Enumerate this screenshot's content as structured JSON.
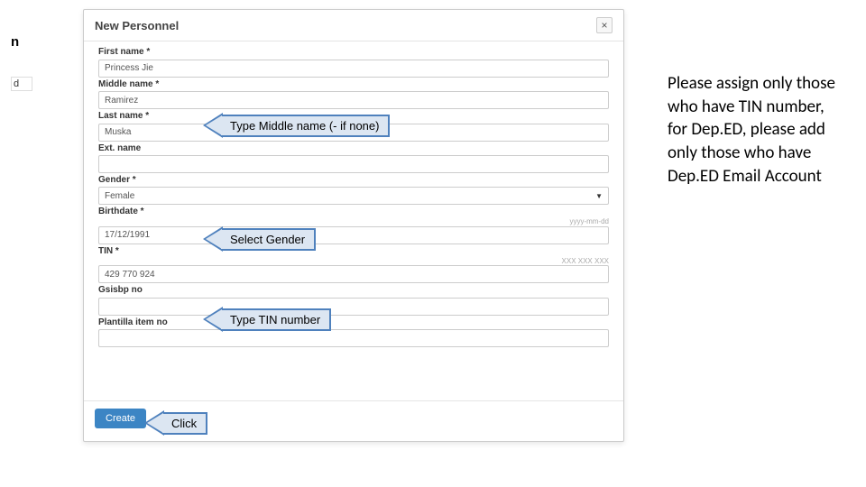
{
  "left_fragments": {
    "frag1": "n",
    "frag2": "d"
  },
  "modal": {
    "title": "New Personnel",
    "close_symbol": "×",
    "fields": {
      "first_name": {
        "label": "First name *",
        "value": "Princess Jie"
      },
      "middle_name": {
        "label": "Middle name *",
        "value": "Ramirez"
      },
      "last_name": {
        "label": "Last name *",
        "value": "Muska"
      },
      "ext_name": {
        "label": "Ext. name",
        "value": ""
      },
      "gender": {
        "label": "Gender *",
        "value": "Female",
        "hint": ""
      },
      "birthdate": {
        "label": "Birthdate *",
        "value": "17/12/1991",
        "hint": "yyyy-mm-dd"
      },
      "tin": {
        "label": "TIN *",
        "value": "429 770 924",
        "hint": "XXX XXX XXX"
      },
      "gsisbp": {
        "label": "Gsisbp no",
        "value": ""
      },
      "plantilla": {
        "label": "Plantilla item no",
        "value": ""
      }
    },
    "create_label": "Create"
  },
  "callouts": {
    "middle": "Type Middle name (- if none)",
    "gender": "Select Gender",
    "tin": "Type TIN number",
    "click": "Click"
  },
  "side_note": "Please assign only those who have TIN number, for Dep.ED, please add only those who have Dep.ED Email Account"
}
